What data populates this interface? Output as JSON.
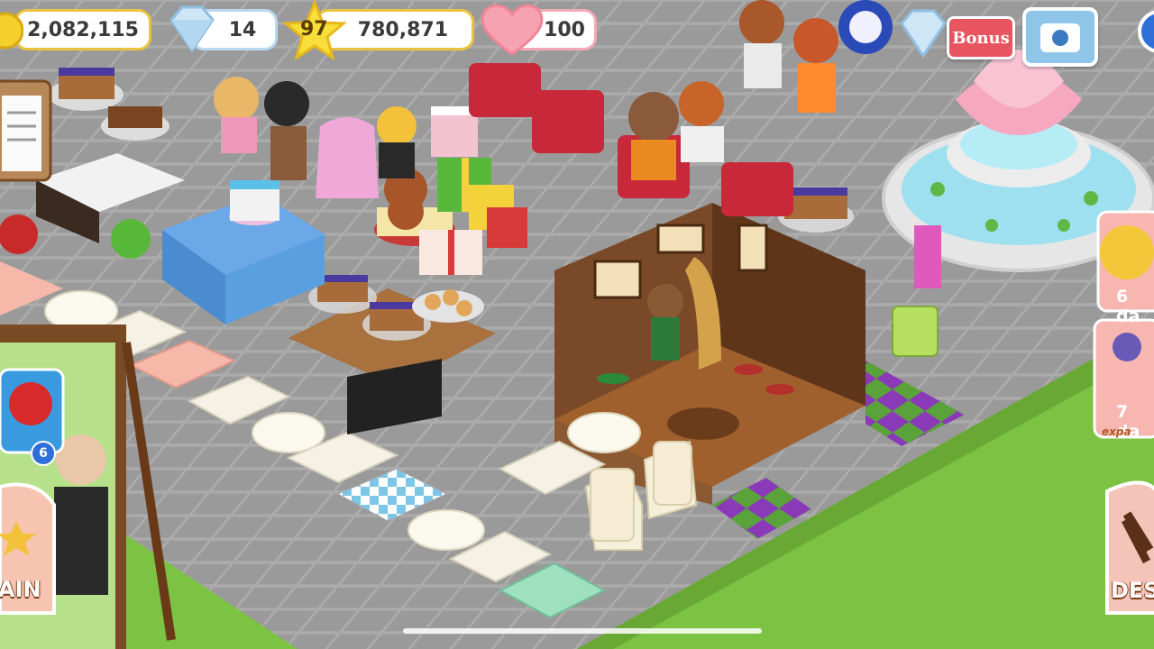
{
  "hud": {
    "coins": "2,082,115",
    "gems": "14",
    "level": "97",
    "experience": "780,871",
    "hearts": "100"
  },
  "buttons": {
    "bonus_label": "Bonus",
    "main_label": "AIN",
    "design_label": "DES"
  },
  "side_panel": {
    "timer_1": "6 da",
    "timer_2": "7 da",
    "caption": "expa"
  },
  "notification_badge": "6",
  "icons": [
    "coin-icon",
    "gem-icon",
    "star-icon",
    "heart-icon",
    "gem-bonus-icon",
    "phone-icon",
    "clipboard-icon",
    "mascot-icon",
    "spatula-icon"
  ],
  "colors": {
    "grass": "#7cc243",
    "floor": "#9a9a9a",
    "bonus_red": "#e8545f",
    "hud_gold": "#e9c33f"
  }
}
